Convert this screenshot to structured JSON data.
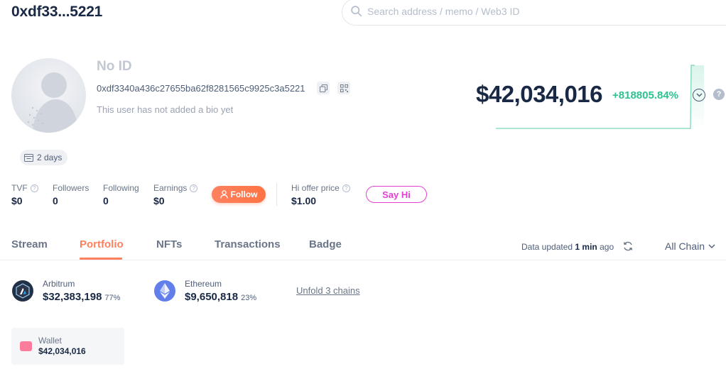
{
  "header": {
    "title": "0xdf33...5221",
    "search_placeholder": "Search address / memo / Web3 ID"
  },
  "profile": {
    "name": "No ID",
    "address": "0xdf3340a436c27655ba62f8281565c9925c3a5221",
    "bio": "This user has not added a bio yet",
    "age": "2 days"
  },
  "networth": {
    "value": "$42,034,016",
    "change": "+818805.84%"
  },
  "stats": [
    {
      "label": "TVF",
      "value": "$0",
      "help": true
    },
    {
      "label": "Followers",
      "value": "0",
      "help": false
    },
    {
      "label": "Following",
      "value": "0",
      "help": false
    },
    {
      "label": "Earnings",
      "value": "$0",
      "help": true
    }
  ],
  "follow_label": "Follow",
  "offer": {
    "label": "Hi offer price",
    "value": "$1.00"
  },
  "sayhi_label": "Say Hi",
  "tabs": [
    {
      "label": "Stream",
      "active": false
    },
    {
      "label": "Portfolio",
      "active": true
    },
    {
      "label": "NFTs",
      "active": false
    },
    {
      "label": "Transactions",
      "active": false
    },
    {
      "label": "Badge",
      "active": false
    }
  ],
  "updated": {
    "prefix": "Data updated",
    "time": "1 min",
    "suffix": "ago"
  },
  "chain_select": "All Chain",
  "chains": [
    {
      "name": "Arbitrum",
      "value": "$32,383,198",
      "percent": "77%",
      "color": "#213147"
    },
    {
      "name": "Ethereum",
      "value": "$9,650,818",
      "percent": "23%",
      "color": "#627eea"
    }
  ],
  "unfold_label": "Unfold 3 chains",
  "wallet": {
    "label": "Wallet",
    "value": "$42,034,016"
  },
  "colors": {
    "accent": "#fe815f",
    "positive": "#2fc28e",
    "sayhi": "#e53fd4",
    "text": "#192945"
  }
}
